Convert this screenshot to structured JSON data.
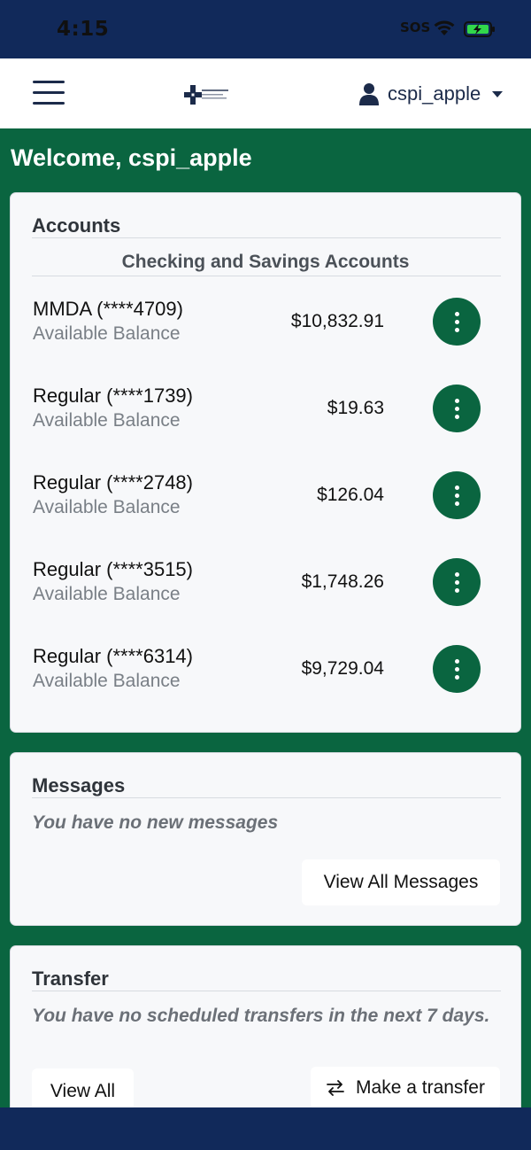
{
  "status_bar": {
    "time": "4:15",
    "sos": "SOS",
    "wifi_icon": "wifi-icon",
    "battery_icon": "battery-charging-icon"
  },
  "navbar": {
    "menu_icon": "hamburger-icon",
    "logo_alt": "Bank logo",
    "username": "cspi_apple",
    "user_icon": "user-icon"
  },
  "welcome": "Welcome, cspi_apple",
  "accounts": {
    "title": "Accounts",
    "subheading": "Checking and Savings Accounts",
    "items": [
      {
        "name": "MMDA (****4709)",
        "label": "Available Balance",
        "balance": "$10,832.91"
      },
      {
        "name": "Regular (****1739)",
        "label": "Available Balance",
        "balance": "$19.63"
      },
      {
        "name": "Regular (****2748)",
        "label": "Available Balance",
        "balance": "$126.04"
      },
      {
        "name": "Regular (****3515)",
        "label": "Available Balance",
        "balance": "$1,748.26"
      },
      {
        "name": "Regular (****6314)",
        "label": "Available Balance",
        "balance": "$9,729.04"
      }
    ]
  },
  "messages": {
    "title": "Messages",
    "note": "You have no new messages",
    "button": "View All Messages"
  },
  "transfer": {
    "title": "Transfer",
    "note": "You have no scheduled transfers in the next 7 days.",
    "view_all": "View All",
    "make_transfer": "Make a transfer"
  },
  "colors": {
    "brand_green": "#0a6540",
    "navy": "#11295a",
    "card_bg": "#f7f8fa"
  }
}
